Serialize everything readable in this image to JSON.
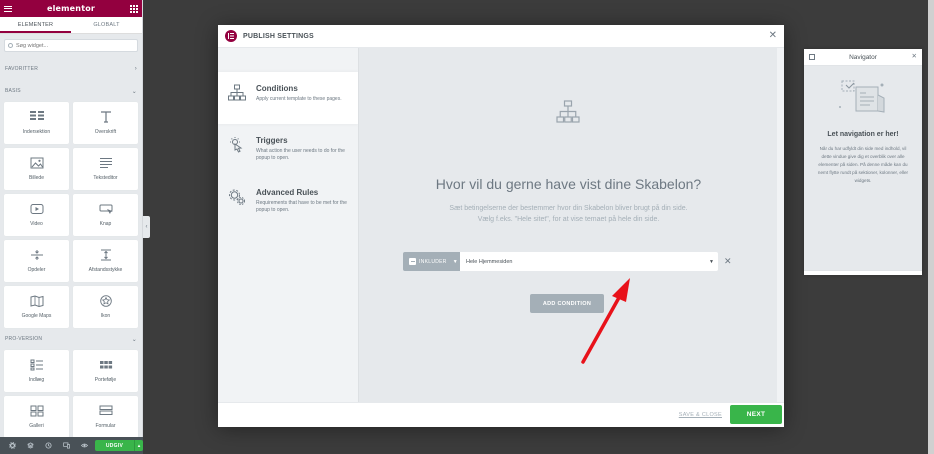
{
  "panel": {
    "logo": "elementor",
    "tabs": [
      "ELEMENTER",
      "GLOBALT"
    ],
    "search_placeholder": "Søg widget...",
    "categories": {
      "favorites": "FAVORITTER",
      "basic": "BASIS",
      "pro": "PRO-VERSION"
    },
    "basic_widgets": [
      {
        "label": "Indersektion",
        "icon": "inner-section-icon"
      },
      {
        "label": "Overskrift",
        "icon": "heading-icon"
      },
      {
        "label": "Billede",
        "icon": "image-icon"
      },
      {
        "label": "Teksteditor",
        "icon": "text-editor-icon"
      },
      {
        "label": "Video",
        "icon": "video-icon"
      },
      {
        "label": "Knap",
        "icon": "button-icon"
      },
      {
        "label": "Opdeler",
        "icon": "divider-icon"
      },
      {
        "label": "Afstandsstykke",
        "icon": "spacer-icon"
      },
      {
        "label": "Google Maps",
        "icon": "map-icon"
      },
      {
        "label": "Ikon",
        "icon": "star-icon"
      }
    ],
    "pro_widgets": [
      {
        "label": "Indlæg",
        "icon": "posts-icon"
      },
      {
        "label": "Portefølje",
        "icon": "portfolio-icon"
      },
      {
        "label": "Galleri",
        "icon": "gallery-icon"
      },
      {
        "label": "Formular",
        "icon": "form-icon"
      }
    ],
    "footer": {
      "publish_label": "UDGIV"
    }
  },
  "modal": {
    "title": "PUBLISH SETTINGS",
    "sidebar": [
      {
        "title": "Conditions",
        "desc": "Apply current template to these pages.",
        "icon": "sitemap-icon"
      },
      {
        "title": "Triggers",
        "desc": "What action the user needs to do for the popup to open.",
        "icon": "pointer-icon"
      },
      {
        "title": "Advanced Rules",
        "desc": "Requirements that have to be met for the popup to open.",
        "icon": "gears-icon"
      }
    ],
    "main": {
      "heading": "Hvor vil du gerne have vist dine Skabelon?",
      "desc_line1": "Sæt betingelserne der bestemmer hvor din Skabelon bliver brugt på din side.",
      "desc_line2": "Vælg f.eks. \"Hele sitet\", for at vise temaet på hele din side.",
      "include_label": "INKLUDER",
      "condition_value": "Hele Hjemmesiden",
      "add_condition_label": "ADD CONDITION"
    },
    "footer": {
      "save_close_label": "SAVE & CLOSE",
      "next_label": "NEXT"
    }
  },
  "navigator": {
    "title": "Navigator",
    "heading": "Let navigation er her!",
    "text": "Når du har udfyldt din side med indhold, vil dette vindue give dig et overblik over alle elementer på siden. På denne måde kan du nemt flytte rundt på sektioner, kolonner, eller widgets."
  },
  "colors": {
    "brand": "#93003f",
    "green": "#39b54a",
    "annotation_arrow": "#e8121a"
  }
}
